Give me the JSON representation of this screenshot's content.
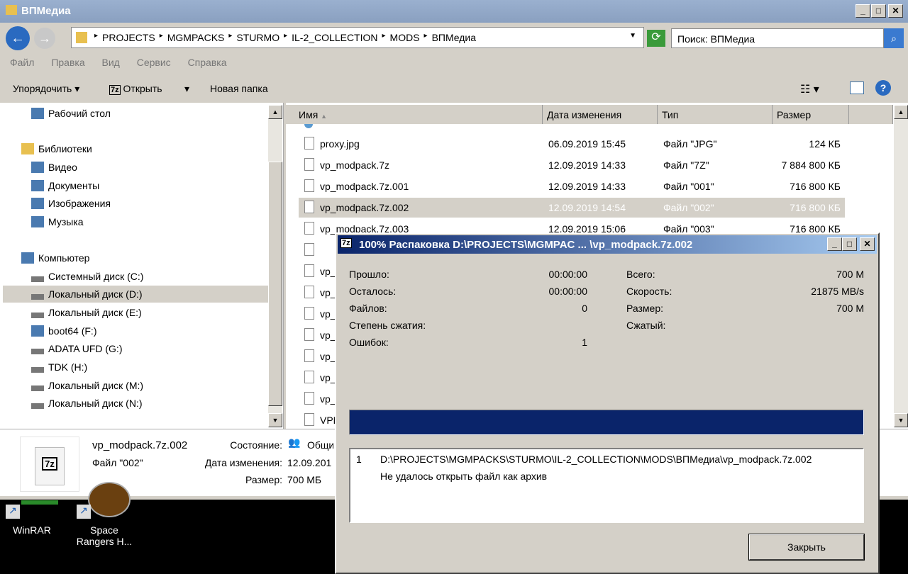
{
  "window": {
    "title": "ВПМедиа"
  },
  "address": {
    "segments": [
      "PROJECTS",
      "MGMPACKS",
      "STURMO",
      "IL-2_COLLECTION",
      "MODS",
      "ВПМедиа"
    ],
    "search_placeholder": "Поиск: ВПМедиа"
  },
  "menu": [
    "Файл",
    "Правка",
    "Вид",
    "Сервис",
    "Справка"
  ],
  "toolbar": {
    "organize": "Упорядочить",
    "open": "Открыть",
    "new_folder": "Новая папка"
  },
  "nav": [
    {
      "label": "Рабочий стол",
      "icon": "desktop-icon"
    },
    {
      "label": "Библиотеки",
      "icon": "libraries-icon"
    },
    {
      "label": "Видео",
      "icon": "video-icon"
    },
    {
      "label": "Документы",
      "icon": "documents-icon"
    },
    {
      "label": "Изображения",
      "icon": "pictures-icon"
    },
    {
      "label": "Музыка",
      "icon": "music-icon"
    },
    {
      "label": "Компьютер",
      "icon": "computer-icon"
    },
    {
      "label": "Системный диск (C:)",
      "icon": "drive-icon"
    },
    {
      "label": "Локальный диск (D:)",
      "icon": "drive-icon"
    },
    {
      "label": "Локальный диск (E:)",
      "icon": "drive-icon"
    },
    {
      "label": "boot64 (F:)",
      "icon": "usb-drive-icon"
    },
    {
      "label": "ADATA UFD (G:)",
      "icon": "drive-icon"
    },
    {
      "label": "TDK (H:)",
      "icon": "drive-icon"
    },
    {
      "label": "Локальный диск  (M:)",
      "icon": "drive-icon"
    },
    {
      "label": "Локальный диск (N:)",
      "icon": "drive-icon"
    }
  ],
  "columns": [
    "Имя",
    "Дата изменения",
    "Тип",
    "Размер"
  ],
  "files": [
    {
      "name": "proxy.jpg",
      "date": "06.09.2019 15:45",
      "type": "Файл \"JPG\"",
      "size": "124 КБ"
    },
    {
      "name": "vp_modpack.7z",
      "date": "12.09.2019 14:33",
      "type": "Файл \"7Z\"",
      "size": "7 884 800 КБ"
    },
    {
      "name": "vp_modpack.7z.001",
      "date": "12.09.2019 14:33",
      "type": "Файл \"001\"",
      "size": "716 800 КБ"
    },
    {
      "name": "vp_modpack.7z.002",
      "date": "12.09.2019 14:54",
      "type": "Файл \"002\"",
      "size": "716 800 КБ",
      "selected": true
    },
    {
      "name": "vp_modpack.7z.003",
      "date": "12.09.2019 15:06",
      "type": "Файл \"003\"",
      "size": "716 800 КБ"
    }
  ],
  "hidden_rows": [
    "",
    "vp_",
    "vp_",
    "vp_",
    "vp_",
    "vp_",
    "vp_",
    "vp_",
    "VPM"
  ],
  "details": {
    "name": "vp_modpack.7z.002",
    "type": "Файл \"002\"",
    "state_label": "Состояние:",
    "state_value": "Общи",
    "date_label": "Дата изменения:",
    "date_value": "12.09.201",
    "size_label": "Размер:",
    "size_value": "700 МБ"
  },
  "desktop": [
    {
      "label": "WinRAR"
    },
    {
      "label": "Space Rangers H..."
    }
  ],
  "dialog": {
    "title": "100% Распаковка D:\\PROJECTS\\MGMPAC ... \\vp_modpack.7z.002",
    "elapsed_label": "Прошло:",
    "elapsed": "00:00:00",
    "remaining_label": "Осталось:",
    "remaining": "00:00:00",
    "files_label": "Файлов:",
    "files": "0",
    "ratio_label": "Степень сжатия:",
    "errors_label": "Ошибок:",
    "errors": "1",
    "total_label": "Всего:",
    "total": "700 M",
    "speed_label": "Скорость:",
    "speed": "21875 MB/s",
    "size_label": "Размер:",
    "size": "700 M",
    "packed_label": "Сжатый:",
    "progress": 100,
    "log_index": "1",
    "log_path": "D:\\PROJECTS\\MGMPACKS\\STURMO\\IL-2_COLLECTION\\MODS\\ВПМедиа\\vp_modpack.7z.002",
    "log_message": "Не удалось открыть файл как архив",
    "close": "Закрыть",
    "bar_color": "#0a246a"
  }
}
